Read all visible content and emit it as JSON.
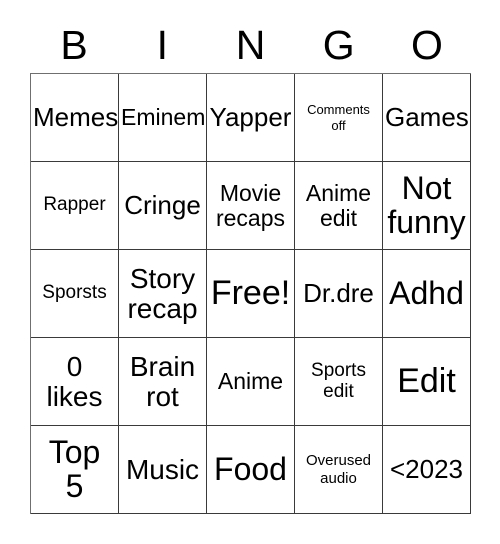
{
  "card": {
    "title": "BINGO",
    "background_color": "#ffffff",
    "text_color": "#000000",
    "grid_line_color": "#3a3a3a",
    "outer_border_color": "#6f6f6f",
    "columns": 5,
    "rows": 5
  },
  "header": {
    "letters": [
      "B",
      "I",
      "N",
      "G",
      "O"
    ]
  },
  "grid": {
    "rows": [
      {
        "cells": [
          {
            "text": "Memes",
            "size": "s-xl",
            "free": false
          },
          {
            "text": "Eminem",
            "size": "s-lg",
            "free": false
          },
          {
            "text": "Yapper",
            "size": "s-xl",
            "free": false
          },
          {
            "text": "Comments\noff",
            "size": "s-xs",
            "free": false
          },
          {
            "text": "Games",
            "size": "s-xl",
            "free": false
          }
        ]
      },
      {
        "cells": [
          {
            "text": "Rapper",
            "size": "s-md",
            "free": false
          },
          {
            "text": "Cringe",
            "size": "s-xl",
            "free": false
          },
          {
            "text": "Movie\nrecaps",
            "size": "s-lg",
            "free": false
          },
          {
            "text": "Anime\nedit",
            "size": "s-lg",
            "free": false
          },
          {
            "text": "Not\nfunny",
            "size": "s-huge",
            "free": false
          }
        ]
      },
      {
        "cells": [
          {
            "text": "Sporsts",
            "size": "s-md",
            "free": false
          },
          {
            "text": "Story\nrecap",
            "size": "s-xxl",
            "free": false
          },
          {
            "text": "Free!",
            "size": "s-max",
            "free": true
          },
          {
            "text": "Dr.dre",
            "size": "s-xl",
            "free": false
          },
          {
            "text": "Adhd",
            "size": "s-huge",
            "free": false
          }
        ]
      },
      {
        "cells": [
          {
            "text": "0\nlikes",
            "size": "s-xxl",
            "free": false
          },
          {
            "text": "Brain\nrot",
            "size": "s-xxl",
            "free": false
          },
          {
            "text": "Anime",
            "size": "s-lg",
            "free": false
          },
          {
            "text": "Sports\nedit",
            "size": "s-md",
            "free": false
          },
          {
            "text": "Edit",
            "size": "s-max",
            "free": false
          }
        ]
      },
      {
        "cells": [
          {
            "text": "Top\n5",
            "size": "s-huge",
            "free": false
          },
          {
            "text": "Music",
            "size": "s-xxl",
            "free": false
          },
          {
            "text": "Food",
            "size": "s-huge",
            "free": false
          },
          {
            "text": "Overused\naudio",
            "size": "s-sm",
            "free": false
          },
          {
            "text": "<2023",
            "size": "s-xl",
            "free": false
          }
        ]
      }
    ]
  }
}
